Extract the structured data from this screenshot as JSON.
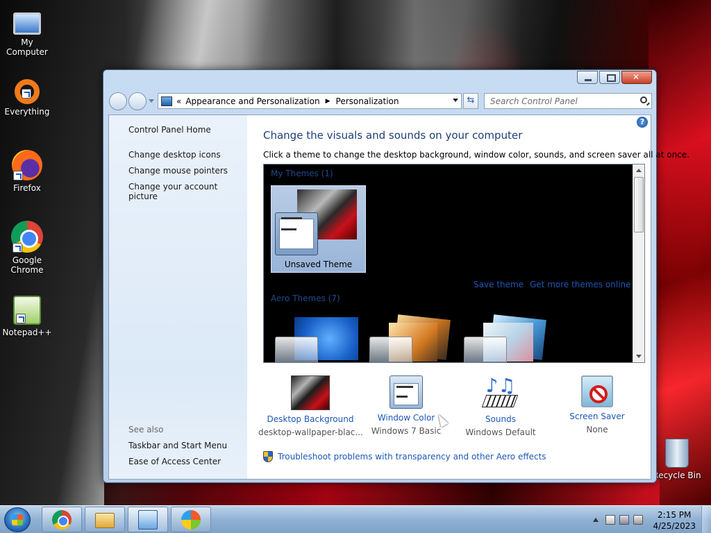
{
  "desktop": {
    "icons": [
      {
        "label": "My Computer",
        "icon": "computer-icon"
      },
      {
        "label": "Everything",
        "icon": "everything-icon"
      },
      {
        "label": "Firefox",
        "icon": "firefox-icon"
      },
      {
        "label": "Google Chrome",
        "icon": "chrome-icon"
      },
      {
        "label": "Notepad++",
        "icon": "notepad-plus-plus-icon"
      },
      {
        "label": "Recycle Bin",
        "icon": "recycle-bin-icon"
      }
    ]
  },
  "window": {
    "address": {
      "prefix": "«",
      "crumbs": [
        "Appearance and Personalization",
        "Personalization"
      ]
    },
    "search_placeholder": "Search Control Panel",
    "sidebar": {
      "home": "Control Panel Home",
      "links": [
        "Change desktop icons",
        "Change mouse pointers",
        "Change your account picture"
      ],
      "see_also": "See also",
      "see_also_links": [
        "Taskbar and Start Menu",
        "Ease of Access Center"
      ]
    },
    "main": {
      "heading": "Change the visuals and sounds on your computer",
      "subtext": "Click a theme to change the desktop background, window color, sounds, and screen saver all at once.",
      "my_themes_title": "My Themes (1)",
      "unsaved_theme": "Unsaved Theme",
      "save_theme": "Save theme",
      "more_themes": "Get more themes online",
      "aero_themes_title": "Aero Themes (7)",
      "options": [
        {
          "title": "Desktop Background",
          "sub": "desktop-wallpaper-blac...",
          "icon": "desktop-background-icon"
        },
        {
          "title": "Window Color",
          "sub": "Windows 7 Basic",
          "icon": "window-color-icon"
        },
        {
          "title": "Sounds",
          "sub": "Windows Default",
          "icon": "sounds-icon"
        },
        {
          "title": "Screen Saver",
          "sub": "None",
          "icon": "screen-saver-icon"
        }
      ],
      "troubleshoot": "Troubleshoot problems with transparency and other Aero effects"
    }
  },
  "taskbar": {
    "time": "2:15 PM",
    "date": "4/25/2023"
  }
}
